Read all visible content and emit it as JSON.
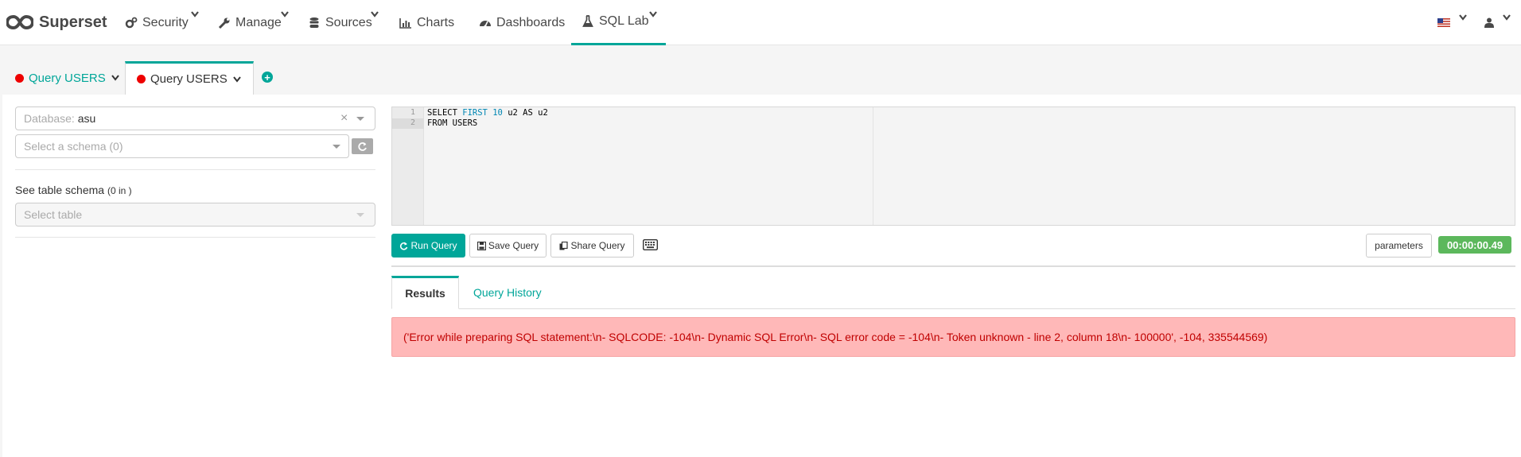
{
  "brand": {
    "name": "Superset"
  },
  "nav": {
    "items": [
      {
        "label": "Security",
        "icon": "cogs-icon",
        "dropdown": true
      },
      {
        "label": "Manage",
        "icon": "wrench-icon",
        "dropdown": true
      },
      {
        "label": "Sources",
        "icon": "database-icon",
        "dropdown": true
      },
      {
        "label": "Charts",
        "icon": "bar-chart-icon",
        "dropdown": false
      },
      {
        "label": "Dashboards",
        "icon": "dashboard-icon",
        "dropdown": false
      },
      {
        "label": "SQL Lab",
        "icon": "flask-icon",
        "dropdown": true,
        "active": true
      }
    ]
  },
  "query_tabs": [
    {
      "label": "Query USERS",
      "active": false
    },
    {
      "label": "Query USERS",
      "active": true
    }
  ],
  "left_pane": {
    "database_label": "Database:",
    "database_value": "asu",
    "schema_placeholder": "Select a schema (0)",
    "table_schema_label": "See table schema",
    "table_schema_count": "(0 in )",
    "table_placeholder": "Select table"
  },
  "editor": {
    "lines": [
      {
        "num": "1",
        "text": "SELECT FIRST 10 u2 AS u2"
      },
      {
        "num": "2",
        "text": "FROM USERS"
      }
    ]
  },
  "toolbar": {
    "run_label": "Run Query",
    "save_label": "Save Query",
    "share_label": "Share Query",
    "parameters_label": "parameters",
    "timer": "00:00:00.49"
  },
  "result_tabs": {
    "results_label": "Results",
    "history_label": "Query History"
  },
  "error": {
    "message": "('Error while preparing SQL statement:\\n- SQLCODE: -104\\n- Dynamic SQL Error\\n- SQL error code = -104\\n- Token unknown - line 2, column 18\\n- 100000', -104, 335544569)"
  },
  "colors": {
    "accent": "#00a699",
    "error_bg": "#ffb8b8",
    "error_text": "#c00000",
    "timer_bg": "#5cb85c",
    "unsaved_dot": "#ee0000"
  }
}
